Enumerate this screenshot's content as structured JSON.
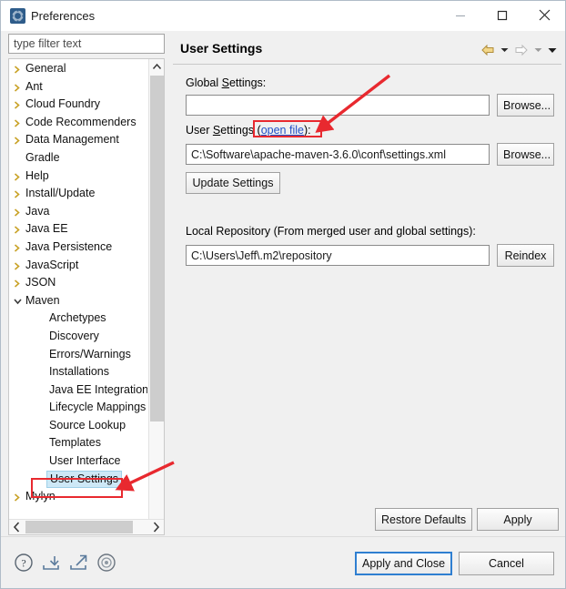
{
  "window": {
    "title": "Preferences",
    "icon": "preferences-gear-icon",
    "controls": {
      "minimize": "minimize-icon",
      "maximize": "maximize-icon",
      "close": "close-icon"
    }
  },
  "sidebar": {
    "filter": {
      "value": "",
      "placeholder": "type filter text"
    },
    "items": [
      {
        "label": "General",
        "level": 0,
        "expandable": true,
        "expanded": false,
        "selected": false
      },
      {
        "label": "Ant",
        "level": 0,
        "expandable": true,
        "expanded": false,
        "selected": false
      },
      {
        "label": "Cloud Foundry",
        "level": 0,
        "expandable": true,
        "expanded": false,
        "selected": false
      },
      {
        "label": "Code Recommenders",
        "level": 0,
        "expandable": true,
        "expanded": false,
        "selected": false
      },
      {
        "label": "Data Management",
        "level": 0,
        "expandable": true,
        "expanded": false,
        "selected": false
      },
      {
        "label": "Gradle",
        "level": 0,
        "expandable": false,
        "expanded": false,
        "selected": false
      },
      {
        "label": "Help",
        "level": 0,
        "expandable": true,
        "expanded": false,
        "selected": false
      },
      {
        "label": "Install/Update",
        "level": 0,
        "expandable": true,
        "expanded": false,
        "selected": false
      },
      {
        "label": "Java",
        "level": 0,
        "expandable": true,
        "expanded": false,
        "selected": false
      },
      {
        "label": "Java EE",
        "level": 0,
        "expandable": true,
        "expanded": false,
        "selected": false
      },
      {
        "label": "Java Persistence",
        "level": 0,
        "expandable": true,
        "expanded": false,
        "selected": false
      },
      {
        "label": "JavaScript",
        "level": 0,
        "expandable": true,
        "expanded": false,
        "selected": false
      },
      {
        "label": "JSON",
        "level": 0,
        "expandable": true,
        "expanded": false,
        "selected": false
      },
      {
        "label": "Maven",
        "level": 0,
        "expandable": true,
        "expanded": true,
        "selected": false
      },
      {
        "label": "Archetypes",
        "level": 1,
        "expandable": false,
        "expanded": false,
        "selected": false
      },
      {
        "label": "Discovery",
        "level": 1,
        "expandable": false,
        "expanded": false,
        "selected": false
      },
      {
        "label": "Errors/Warnings",
        "level": 1,
        "expandable": false,
        "expanded": false,
        "selected": false
      },
      {
        "label": "Installations",
        "level": 1,
        "expandable": false,
        "expanded": false,
        "selected": false
      },
      {
        "label": "Java EE Integration",
        "level": 1,
        "expandable": false,
        "expanded": false,
        "selected": false
      },
      {
        "label": "Lifecycle Mappings",
        "level": 1,
        "expandable": false,
        "expanded": false,
        "selected": false
      },
      {
        "label": "Source Lookup",
        "level": 1,
        "expandable": false,
        "expanded": false,
        "selected": false
      },
      {
        "label": "Templates",
        "level": 1,
        "expandable": false,
        "expanded": false,
        "selected": false
      },
      {
        "label": "User Interface",
        "level": 1,
        "expandable": false,
        "expanded": false,
        "selected": false
      },
      {
        "label": "User Settings",
        "level": 1,
        "expandable": false,
        "expanded": false,
        "selected": true
      },
      {
        "label": "Mylyn",
        "level": 0,
        "expandable": true,
        "expanded": false,
        "selected": false
      }
    ],
    "scrollbars": {
      "vertical_up": "scroll-up-icon",
      "vertical_down": "scroll-down-icon",
      "horizontal_left": "scroll-left-icon",
      "horizontal_right": "scroll-right-icon"
    }
  },
  "panel": {
    "title": "User Settings",
    "nav": {
      "back": "back-arrow-icon",
      "back_menu": "chevron-down-icon",
      "forward": "forward-arrow-icon",
      "forward_menu": "chevron-down-icon",
      "view_menu": "chevron-down-icon"
    },
    "global_settings": {
      "label_pre": "Global ",
      "label_mnemonic": "S",
      "label_post": "ettings:",
      "value": "",
      "browse_label": "Browse..."
    },
    "user_settings": {
      "label_pre": "User ",
      "label_mnemonic": "S",
      "label_mid": "ettings ",
      "link_open_paren": "(",
      "link_text": "open file",
      "link_close_paren": "):",
      "value": "C:\\Software\\apache-maven-3.6.0\\conf\\settings.xml",
      "browse_label": "Browse...",
      "update_label": "Update Settings"
    },
    "local_repository": {
      "label": "Local Repository (From merged user and global settings):",
      "value": "C:\\Users\\Jeff\\.m2\\repository",
      "reindex_label": "Reindex"
    },
    "restore_defaults_label": "Restore Defaults",
    "apply_label": "Apply"
  },
  "bottom_bar": {
    "icons": [
      {
        "name": "help-icon"
      },
      {
        "name": "import-icon"
      },
      {
        "name": "export-icon"
      },
      {
        "name": "target-icon"
      }
    ],
    "apply_and_close_label": "Apply and Close",
    "cancel_label": "Cancel"
  },
  "annotations": {
    "color": "#e8292f",
    "boxes": [
      {
        "name": "open-file-link-highlight"
      },
      {
        "name": "user-settings-tree-item-highlight"
      }
    ],
    "arrows": [
      {
        "name": "arrow-to-open-file-link"
      },
      {
        "name": "arrow-to-user-settings-item"
      }
    ]
  }
}
